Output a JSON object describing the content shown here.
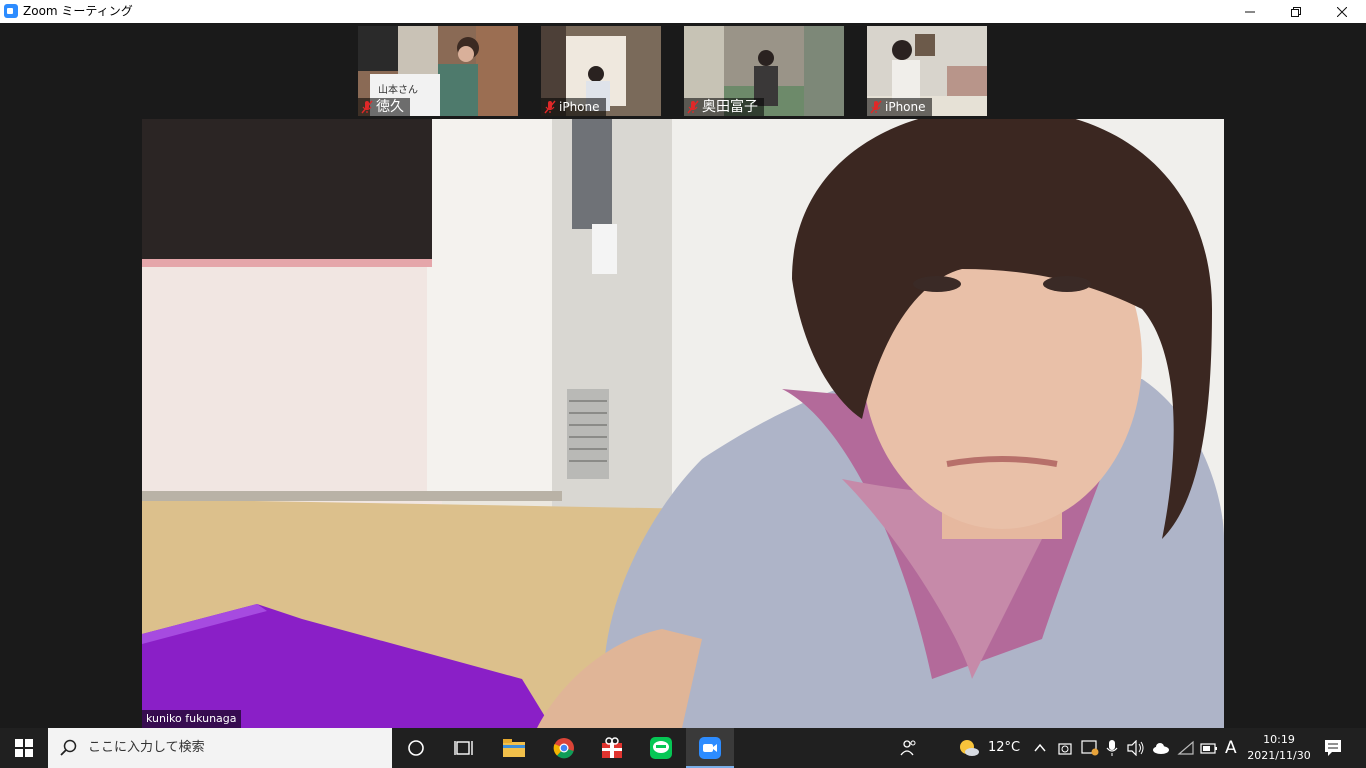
{
  "window": {
    "title": "Zoom ミーティング",
    "controls": [
      "minimize-icon",
      "restore-icon",
      "close-icon"
    ]
  },
  "gallery": [
    {
      "name": "徳久",
      "sign_text": "山本さん",
      "muted": true
    },
    {
      "name": "iPhone",
      "muted": true
    },
    {
      "name": "奥田富子",
      "muted": true
    },
    {
      "name": "iPhone",
      "muted": true
    }
  ],
  "main_video": {
    "name": "kuniko fukunaga"
  },
  "taskbar": {
    "search_placeholder": "ここに入力して検索",
    "pinned": [
      "cortana-icon",
      "task-view-icon",
      "file-explorer-icon",
      "chrome-icon",
      "gift-icon",
      "line-icon",
      "zoom-icon"
    ],
    "weather_temp": "12°C",
    "ime_mode": "A",
    "time": "10:19",
    "date": "2021/11/30"
  },
  "colors": {
    "accent": "#2d8cff",
    "muted_red": "#e02828",
    "taskbar_bg": "#202020",
    "stage_bg": "#1a1a1a"
  }
}
